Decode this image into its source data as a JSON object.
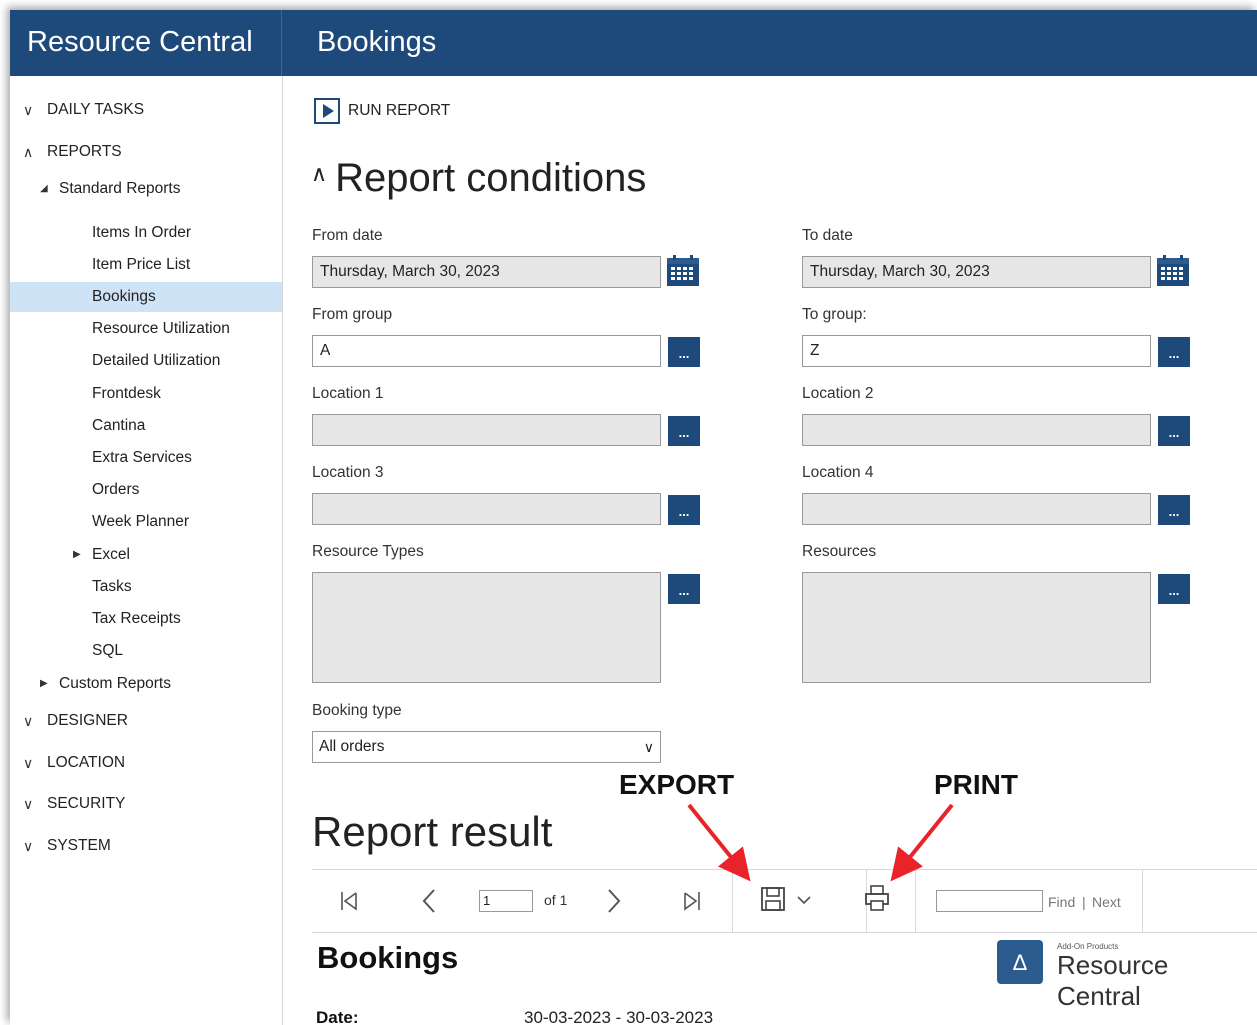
{
  "header": {
    "app_title": "Resource Central",
    "page_title": "Bookings"
  },
  "sidebar": {
    "daily_tasks": "DAILY TASKS",
    "reports": "REPORTS",
    "standard_reports": "Standard Reports",
    "items": [
      "Items In Order",
      "Item Price List",
      "Bookings",
      "Resource Utilization",
      "Detailed Utilization",
      "Frontdesk",
      "Cantina",
      "Extra Services",
      "Orders",
      "Week Planner",
      "Excel",
      "Tasks",
      "Tax Receipts",
      "SQL"
    ],
    "active_item": "Bookings",
    "custom_reports": "Custom Reports",
    "designer": "DESIGNER",
    "location": "LOCATION",
    "security": "SECURITY",
    "system": "SYSTEM"
  },
  "toolbar": {
    "run_report": "RUN REPORT"
  },
  "conditions": {
    "heading": "Report conditions",
    "from_date_label": "From date",
    "from_date_value": "Thursday, March 30, 2023",
    "to_date_label": "To date",
    "to_date_value": "Thursday, March 30, 2023",
    "from_group_label": "From group",
    "from_group_value": "A",
    "to_group_label": "To group:",
    "to_group_value": "Z",
    "location1_label": "Location 1",
    "location2_label": "Location 2",
    "location3_label": "Location 3",
    "location4_label": "Location 4",
    "resource_types_label": "Resource Types",
    "resources_label": "Resources",
    "booking_type_label": "Booking type",
    "booking_type_value": "All orders",
    "browse_label": "..."
  },
  "annotations": {
    "export": "EXPORT",
    "print": "PRINT"
  },
  "result": {
    "heading": "Report result",
    "page_value": "1",
    "of_text": "of 1",
    "find": "Find",
    "find_sep": "|",
    "next": "Next",
    "report_title": "Bookings",
    "logo_small": "Add-On Products",
    "logo_name": "Resource Central",
    "date_label": "Date:",
    "date_value": "30-03-2023 - 30-03-2023"
  },
  "colors": {
    "brand": "#1d4a7a",
    "active_row": "#cfe3f6",
    "arrow": "#e8232a"
  }
}
